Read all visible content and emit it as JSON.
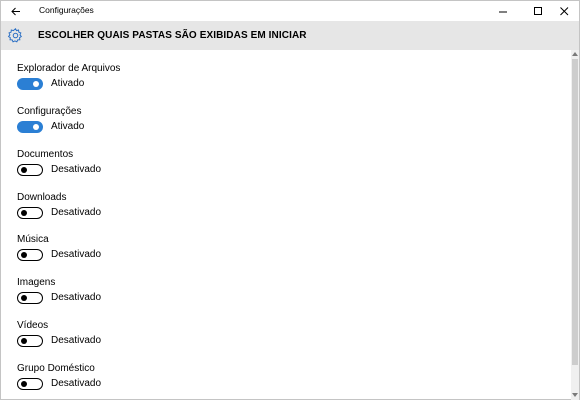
{
  "window": {
    "title": "Configurações"
  },
  "header": {
    "title": "ESCOLHER QUAIS PASTAS SÃO EXIBIDAS EM INICIAR",
    "icon": "gear-icon"
  },
  "settings": [
    {
      "label": "Explorador de Arquivos",
      "state": "Ativado",
      "on": true
    },
    {
      "label": "Configurações",
      "state": "Ativado",
      "on": true
    },
    {
      "label": "Documentos",
      "state": "Desativado",
      "on": false
    },
    {
      "label": "Downloads",
      "state": "Desativado",
      "on": false
    },
    {
      "label": "Música",
      "state": "Desativado",
      "on": false
    },
    {
      "label": "Imagens",
      "state": "Desativado",
      "on": false
    },
    {
      "label": "Vídeos",
      "state": "Desativado",
      "on": false
    },
    {
      "label": "Grupo Doméstico",
      "state": "Desativado",
      "on": false
    }
  ],
  "colors": {
    "accent": "#2b7fd4",
    "header_bg": "#e6e6e6"
  }
}
